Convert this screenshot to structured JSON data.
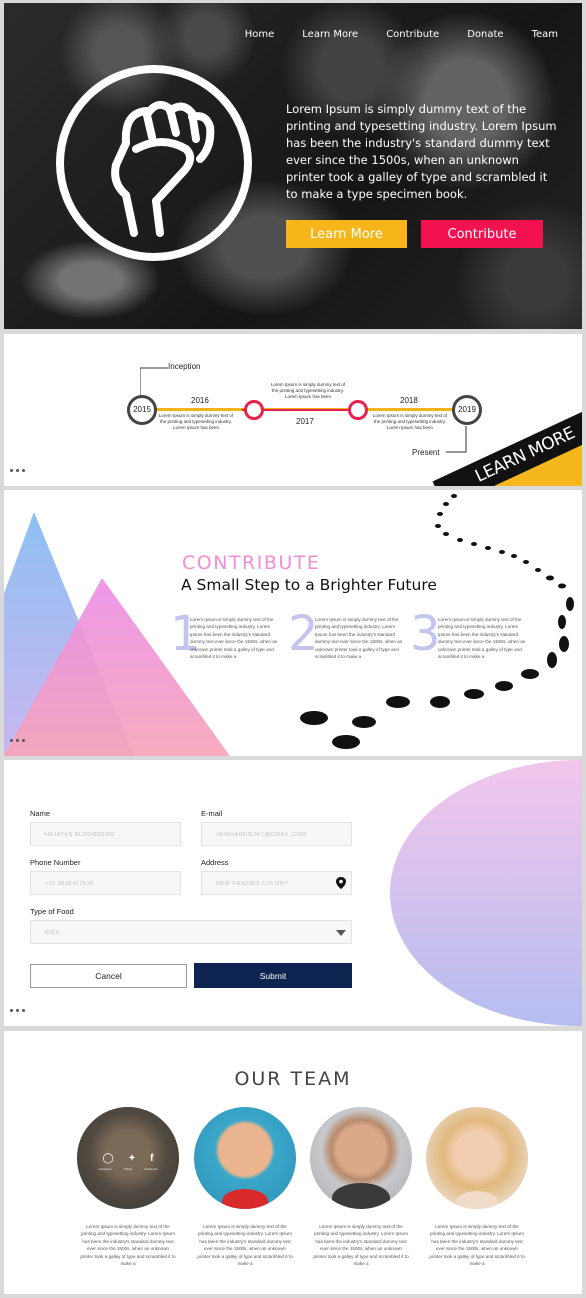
{
  "nav": {
    "items": [
      "Home",
      "Learn More",
      "Contribute",
      "Donate",
      "Team"
    ]
  },
  "hero": {
    "text": "Lorem Ipsum is simply dummy text of the printing and typesetting industry. Lorem Ipsum has been the industry's standard dummy text ever since the 1500s, when an unknown printer took a galley of type and scrambled it to make a type specimen book.",
    "learn_more": "Learn More",
    "contribute": "Contribute",
    "colors": {
      "learn": "#f7b51a",
      "contribute": "#f3114f"
    }
  },
  "timeline": {
    "inception": "Inception",
    "present": "Present",
    "y2015": "2015",
    "y2016": "2016",
    "y2017": "2017",
    "y2018": "2018",
    "y2019": "2019",
    "note1": "Lorem Ipsum is simply dummy text of the printing and typesetting industry. Lorem Ipsum has been",
    "note2": "Lorem Ipsum is simply dummy text of the printing and typesetting industry. Lorem Ipsum has been",
    "note3": "Lorem Ipsum is simply dummy text of the printing and typesetting industry. Lorem Ipsum has been",
    "ribbon": "LEARN MORE"
  },
  "contribute": {
    "title": "CONTRIBUTE",
    "subtitle": "A Small Step to a Brighter Future",
    "steps": [
      {
        "num": "1",
        "text": "Lorem Ipsum is simply dummy text of the printing and typesetting industry. Lorem Ipsum has been the industry's standard dummy text ever since the 1500s, when an unknown printer took a galley of type and scrambled it to make a"
      },
      {
        "num": "2",
        "text": "Lorem Ipsum is simply dummy text of the printing and typesetting industry. Lorem Ipsum has been the industry's standard dummy text ever since the 1500s, when an unknown printer took a galley of type and scrambled it to make a"
      },
      {
        "num": "3",
        "text": "Lorem Ipsum is simply dummy text of the printing and typesetting industry. Lorem Ipsum has been the industry's standard dummy text ever since the 1500s, when an unknown printer took a galley of type and scrambled it to make a"
      }
    ]
  },
  "form": {
    "name_label": "Name",
    "name_value": "HAJATKS BLOOMBERG",
    "email_label": "E-mail",
    "email_value": "JAINHARDIK367@GMAIL.COM",
    "phone_label": "Phone Number",
    "phone_value": "+91 9836427638",
    "address_label": "Address",
    "address_value": "NEW FRIENDS COLONY",
    "food_label": "Type of Food",
    "food_value": "RICE",
    "cancel": "Cancel",
    "submit": "Submit"
  },
  "team": {
    "title": "OUR TEAM",
    "social": {
      "instagram": "Instagram",
      "twitter": "Twitter",
      "facebook": "Facebook"
    },
    "members": [
      {
        "text": "Lorem Ipsum is simply dummy text of the printing and typesetting industry. Lorem Ipsum has been the industry's standard dummy text ever since the 1500s, when an unknown printer took a galley of type and scrambled it to make a"
      },
      {
        "text": "Lorem Ipsum is simply dummy text of the printing and typesetting industry. Lorem Ipsum has been the industry's standard dummy text ever since the 1500s, when an unknown printer took a galley of type and scrambled it to make a"
      },
      {
        "text": "Lorem Ipsum is simply dummy text of the printing and typesetting industry. Lorem Ipsum has been the industry's standard dummy text ever since the 1500s, when an unknown printer took a galley of type and scrambled it to make a"
      },
      {
        "text": "Lorem Ipsum is simply dummy text of the printing and typesetting industry. Lorem Ipsum has been the industry's standard dummy text ever since the 1500s, when an unknown printer took a galley of type and scrambled it to make a"
      }
    ]
  }
}
